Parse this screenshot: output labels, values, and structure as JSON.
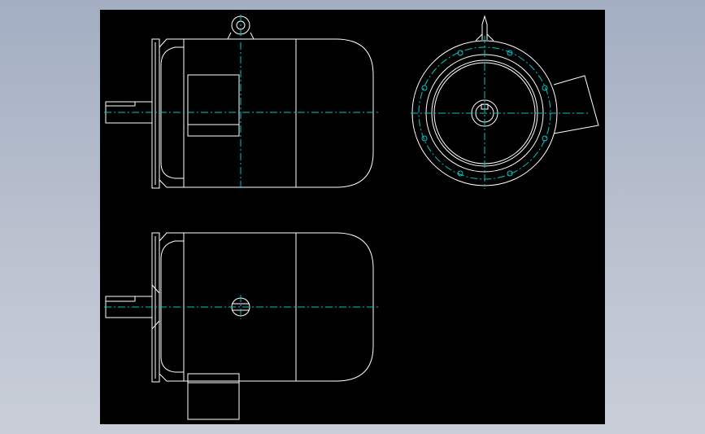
{
  "canvas": {
    "background": "#000000",
    "outline_color": "#ffffff",
    "centerline_color": "#00c8c8",
    "outer_background": "#b3bccb"
  },
  "views": [
    {
      "name": "front-view",
      "description_visible": false
    },
    {
      "name": "end-view",
      "description_visible": false
    },
    {
      "name": "bottom-view",
      "description_visible": false
    }
  ]
}
